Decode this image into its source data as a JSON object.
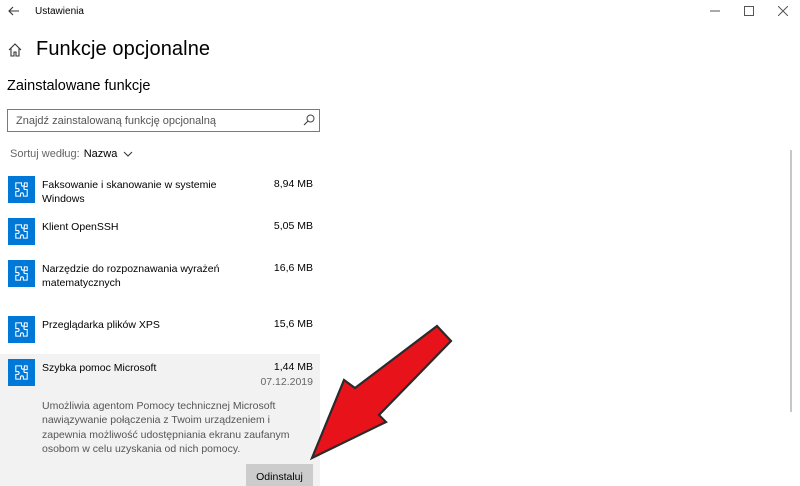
{
  "window": {
    "title": "Ustawienia",
    "controls": [
      "minimize",
      "maximize",
      "close"
    ]
  },
  "header": {
    "title": "Funkcje opcjonalne"
  },
  "section": {
    "title": "Zainstalowane funkcje"
  },
  "search": {
    "placeholder": "Znajdź zainstalowaną funkcję opcjonalną"
  },
  "sort": {
    "label": "Sortuj według:",
    "value": "Nazwa"
  },
  "features": [
    {
      "name": "Faksowanie i skanowanie w systemie Windows",
      "size": "8,94 MB"
    },
    {
      "name": "Klient OpenSSH",
      "size": "5,05 MB"
    },
    {
      "name": "Narzędzie do rozpoznawania wyrażeń matematycznych",
      "size": "16,6 MB"
    },
    {
      "name": "Przeglądarka plików XPS",
      "size": "15,6 MB"
    },
    {
      "name": "Szybka pomoc Microsoft",
      "size": "1,44 MB",
      "date": "07.12.2019",
      "description": "Umożliwia agentom Pomocy technicznej Microsoft nawiązywanie połączenia z Twoim urządzeniem i zapewnia możliwość udostępniania ekranu zaufanym osobom w celu uzyskania od nich pomocy.",
      "uninstall_label": "Odinstaluj",
      "selected": true
    }
  ],
  "icons": {
    "back": "back-arrow-icon",
    "home": "home-icon",
    "search": "search-icon",
    "sort": "chevron-down-icon",
    "feature": "puzzle-piece-icon"
  },
  "colors": {
    "accent": "#0078d7",
    "selected_bg": "#f2f2f2",
    "button_bg": "#cccccc",
    "annotation_arrow": "#e8121b"
  }
}
